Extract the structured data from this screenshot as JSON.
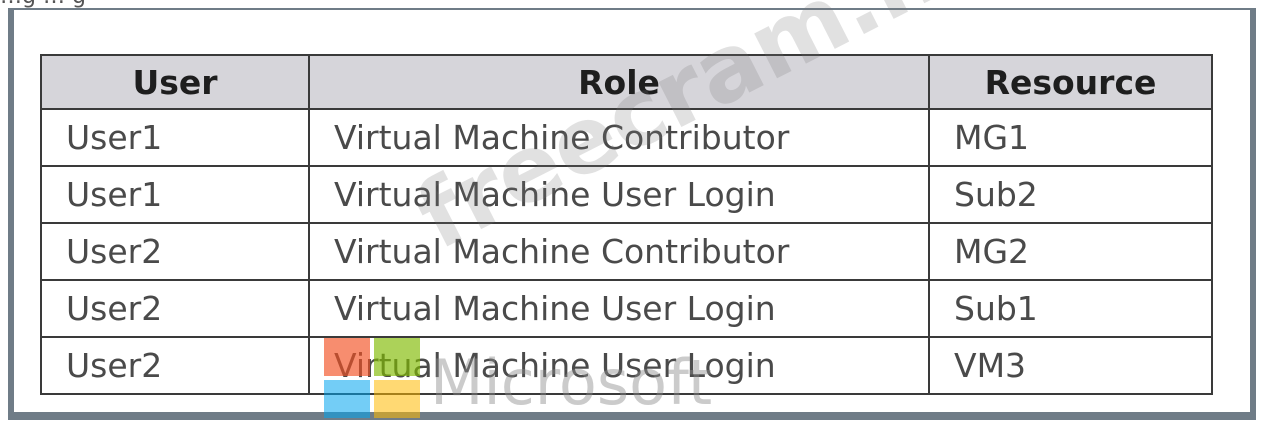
{
  "caption": "…g … g",
  "table": {
    "headers": [
      "User",
      "Role",
      "Resource"
    ],
    "rows": [
      [
        "User1",
        "Virtual Machine Contributor",
        "MG1"
      ],
      [
        "User1",
        "Virtual Machine User Login",
        "Sub2"
      ],
      [
        "User2",
        "Virtual Machine Contributor",
        "MG2"
      ],
      [
        "User2",
        "Virtual Machine User Login",
        "Sub1"
      ],
      [
        "User2",
        "Virtual Machine User Login",
        "VM3"
      ]
    ]
  },
  "watermark": {
    "text": "freecram.net",
    "logo_text": "Microsoft",
    "logo_colors": [
      "#f25022",
      "#7fba00",
      "#00a4ef",
      "#ffb900"
    ]
  }
}
